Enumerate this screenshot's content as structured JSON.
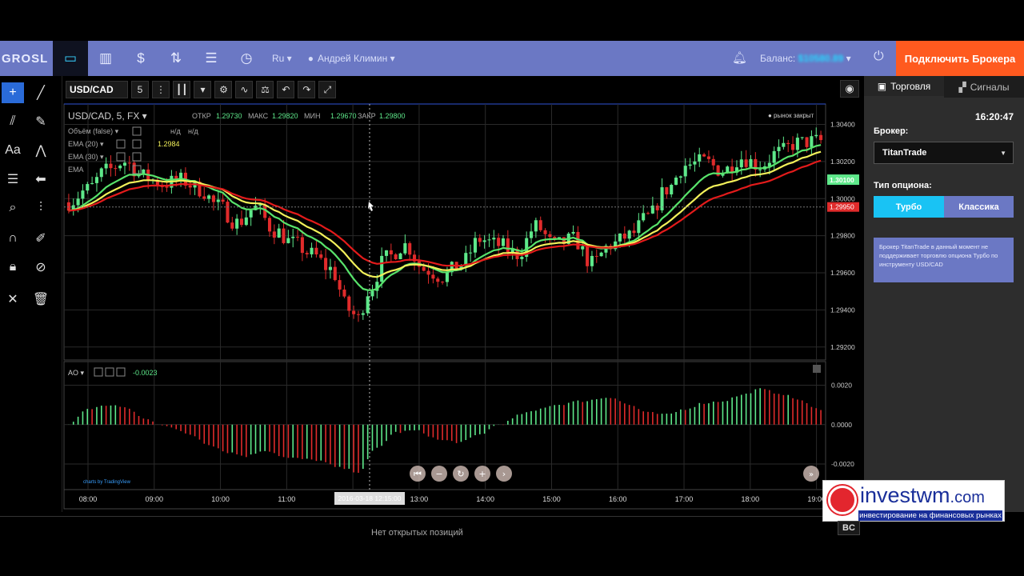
{
  "topnav": {
    "logo": "GROSL",
    "lang": "Ru ▾",
    "user": "Андрей Климин ▾",
    "balance_label": "Баланс:",
    "balance_value": "$10580.89",
    "connect_label": "Подключить Брокера"
  },
  "chart_toolbar": {
    "symbol": "USD/CAD",
    "interval": "5",
    "more": "⋮",
    "candles_dd": "▾",
    "undo": "↶",
    "redo": "↷"
  },
  "legend": {
    "title": "USD/CAD, 5, FX ▾",
    "open_label": "ОТКР",
    "open": "1.29730",
    "high_label": "МАКС",
    "high": "1.29820",
    "low_label": "МИН",
    "low": "1.29670",
    "close_label": "ЗАКР",
    "close": "1.29800",
    "market_status": "● рынок закрыт",
    "volume": "Объём (false) ▾",
    "volume_na1": "н/д",
    "volume_na2": "н/д",
    "ema20": "EMA (20) ▾",
    "ema20_val": "1.2984",
    "ema30": "EMA (30) ▾",
    "ema": "EMA",
    "ao": "AO ▾",
    "ao_val": "-0.0023",
    "credit": "charts by TradingView"
  },
  "right_panel": {
    "tab_trade": "Торговля",
    "tab_signals": "Сигналы",
    "time": "16:20:47",
    "broker_label": "Брокер:",
    "broker_value": "TitanTrade",
    "option_type_label": "Тип опциона:",
    "btn_turbo": "Турбо",
    "btn_classic": "Классика",
    "note": "Брокер TitanTrade в данный момент не поддерживает торговлю опциона Турбо по инструменту USD/CAD"
  },
  "bottom": {
    "empty": "Нет открытых позиций",
    "bc": "BC"
  },
  "watermark": {
    "name": "investwm",
    "tld": ".com",
    "tagline": "инвестирование на финансовых рынках"
  },
  "colors": {
    "nav": "#6b78c4",
    "up": "#5ee88a",
    "down": "#e02b2b",
    "ema_green": "#58e36b",
    "ema_yellow": "#f2f05a",
    "ema_red": "#e31b1b",
    "accent": "#25d8ff",
    "connect": "#ff5a1f"
  },
  "chart_data": {
    "type": "candlestick",
    "price_axis": [
      "1.30400",
      "1.30200",
      "1.30000",
      "1.29800",
      "1.29600",
      "1.29400",
      "1.29200"
    ],
    "price_labels": {
      "last": "1.30100",
      "mark": "1.29950"
    },
    "ylim": [
      1.2913,
      1.3051
    ],
    "osc_axis": [
      "0.0020",
      "0.0000",
      "-0.0020"
    ],
    "osc_ylim": [
      -0.0033,
      0.0032
    ],
    "time_axis": [
      "08:00",
      "09:00",
      "10:00",
      "11:00",
      "12:00",
      "13:00",
      "14:00",
      "15:00",
      "16:00",
      "17:00",
      "18:00",
      "19:00"
    ],
    "cursor_time": "2016-03-18 12:15:00",
    "close_knots": [
      [
        0,
        1.2998
      ],
      [
        4,
        1.3005
      ],
      [
        8,
        1.3015
      ],
      [
        12,
        1.302
      ],
      [
        16,
        1.3012
      ],
      [
        20,
        1.3008
      ],
      [
        24,
        1.301
      ],
      [
        28,
        1.3005
      ],
      [
        32,
        1.2996
      ],
      [
        36,
        1.2987
      ],
      [
        40,
        1.2995
      ],
      [
        44,
        1.2983
      ],
      [
        48,
        1.2976
      ],
      [
        52,
        1.297
      ],
      [
        56,
        1.2962
      ],
      [
        60,
        1.294
      ],
      [
        62,
        1.2935
      ],
      [
        64,
        1.295
      ],
      [
        68,
        1.2968
      ],
      [
        72,
        1.2975
      ],
      [
        76,
        1.2962
      ],
      [
        80,
        1.2958
      ],
      [
        84,
        1.2965
      ],
      [
        88,
        1.2978
      ],
      [
        92,
        1.2975
      ],
      [
        96,
        1.297
      ],
      [
        100,
        1.2985
      ],
      [
        104,
        1.2975
      ],
      [
        108,
        1.2978
      ],
      [
        112,
        1.2965
      ],
      [
        116,
        1.2975
      ],
      [
        120,
        1.298
      ],
      [
        124,
        1.299
      ],
      [
        128,
        1.3005
      ],
      [
        132,
        1.3018
      ],
      [
        136,
        1.302
      ],
      [
        140,
        1.3015
      ],
      [
        144,
        1.3022
      ],
      [
        148,
        1.3018
      ],
      [
        152,
        1.3025
      ],
      [
        156,
        1.303
      ],
      [
        160,
        1.3031
      ]
    ],
    "ao_knots": [
      [
        0,
        0.0
      ],
      [
        4,
        0.0008
      ],
      [
        9,
        0.001
      ],
      [
        13,
        0.0008
      ],
      [
        16,
        0.0003
      ],
      [
        20,
        0.0
      ],
      [
        26,
        -0.0005
      ],
      [
        30,
        -0.001
      ],
      [
        34,
        -0.0014
      ],
      [
        38,
        -0.0016
      ],
      [
        42,
        -0.0013
      ],
      [
        47,
        -0.0017
      ],
      [
        53,
        -0.0018
      ],
      [
        58,
        -0.0022
      ],
      [
        62,
        -0.0024
      ],
      [
        66,
        -0.0012
      ],
      [
        70,
        -0.0004
      ],
      [
        74,
        -0.0003
      ],
      [
        80,
        -0.0008
      ],
      [
        84,
        -0.0009
      ],
      [
        88,
        -0.0005
      ],
      [
        92,
        0.0
      ],
      [
        98,
        0.0006
      ],
      [
        104,
        0.001
      ],
      [
        110,
        0.0012
      ],
      [
        116,
        0.0014
      ],
      [
        120,
        0.001
      ],
      [
        124,
        0.0006
      ],
      [
        128,
        0.0005
      ],
      [
        132,
        0.0008
      ],
      [
        136,
        0.0011
      ],
      [
        140,
        0.0012
      ],
      [
        144,
        0.0015
      ],
      [
        148,
        0.0018
      ],
      [
        152,
        0.0016
      ],
      [
        156,
        0.0013
      ],
      [
        160,
        0.0008
      ]
    ]
  }
}
